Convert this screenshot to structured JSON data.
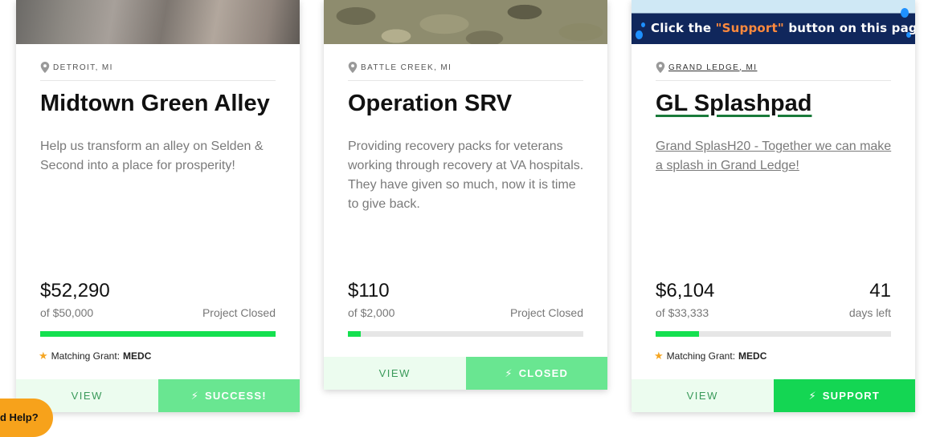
{
  "cards": [
    {
      "location": "DETROIT, MI",
      "title": "Midtown Green Alley",
      "description": "Help us transform an alley on Selden & Second into a place for prosperity!",
      "raised": "$52,290",
      "goal": "of $50,000",
      "status": "Project Closed",
      "progress": 1.0,
      "grant_label": "Matching Grant:",
      "grant_name": "MEDC",
      "view_label": "VIEW",
      "action_label": "SUCCESS!"
    },
    {
      "location": "BATTLE CREEK, MI",
      "title": "Operation SRV",
      "description": "Providing recovery packs for veterans working through recovery at VA hospitals. They have given so much, now it is time to give back.",
      "raised": "$110",
      "goal": "of $2,000",
      "status": "Project Closed",
      "progress": 0.055,
      "view_label": "VIEW",
      "action_label": "CLOSED"
    },
    {
      "location": "GRAND LEDGE, MI",
      "banner_text_pre": "Click the ",
      "banner_text_highlight": "\"Support\"",
      "banner_text_post": " button on this page!",
      "title": "GL Splashpad",
      "description": "Grand SplasH20 - Together we can make a splash in Grand Ledge!",
      "raised": "$6,104",
      "goal": "of $33,333",
      "days_left": "41",
      "days_left_label": "days left",
      "progress": 0.183,
      "grant_label": "Matching Grant:",
      "grant_name": "MEDC",
      "view_label": "VIEW",
      "action_label": "SUPPORT"
    }
  ],
  "help_button": "d Help?",
  "colors": {
    "progress_fill": "#14e04f",
    "progress_track": "#e6e6e6",
    "button_primary": "#14d653",
    "button_muted": "#69e691",
    "view_bg": "#ecfcef",
    "help_bg": "#f7a21b",
    "star": "#f5a623"
  }
}
